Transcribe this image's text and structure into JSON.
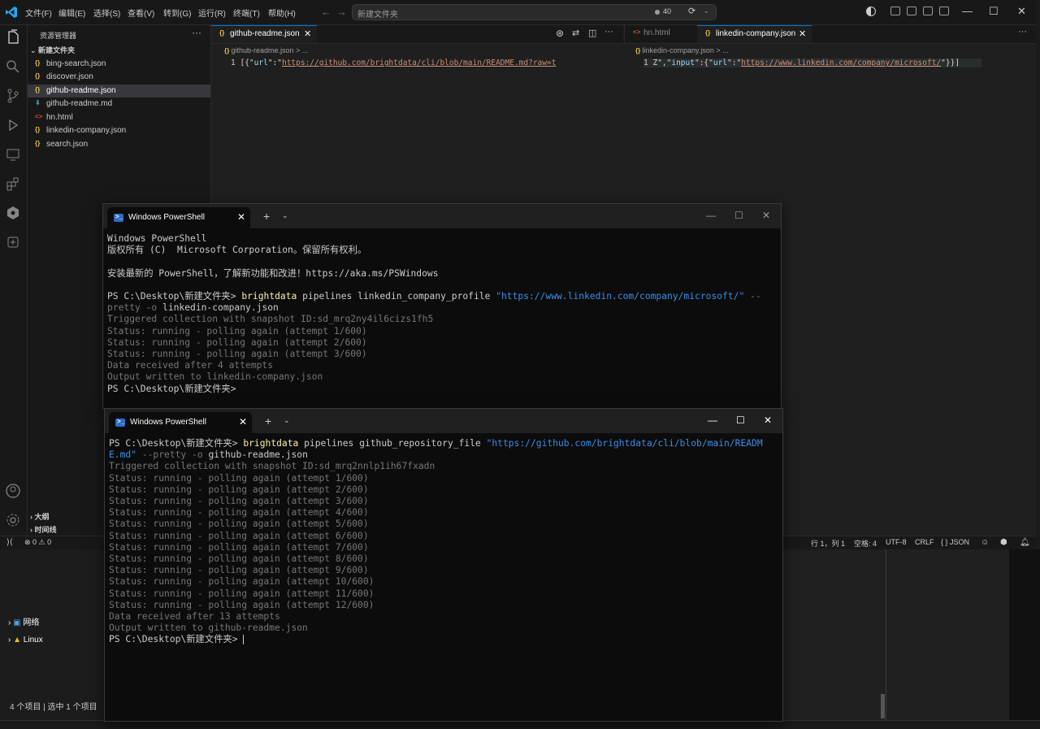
{
  "vscode": {
    "menu": [
      "文件(F)",
      "编辑(E)",
      "选择(S)",
      "查看(V)",
      "转到(G)",
      "运行(R)",
      "终端(T)",
      "帮助(H)"
    ],
    "command_center": {
      "placeholder": "新建文件夹",
      "count": "40"
    },
    "sidebar": {
      "title": "资源管理器",
      "more": "···",
      "folder": "新建文件夹",
      "files": [
        {
          "name": "bing-search.json",
          "icon": "{}"
        },
        {
          "name": "discover.json",
          "icon": "{}"
        },
        {
          "name": "github-readme.json",
          "icon": "{}",
          "selected": true
        },
        {
          "name": "github-readme.md",
          "icon": "⬇"
        },
        {
          "name": "hn.html",
          "icon": "<>"
        },
        {
          "name": "linkedin-company.json",
          "icon": "{}"
        },
        {
          "name": "search.json",
          "icon": "{}"
        }
      ],
      "outline": "大纲",
      "timeline": "时间线"
    },
    "editor_left": {
      "tab": "github-readme.json",
      "breadcrumb": "github-readme.json  >  ...",
      "line_number": "1",
      "code": {
        "p1": "[{\"",
        "key": "url",
        "p2": "\":\"",
        "value": "https://github.com/brightdata/cli/blob/main/README.md?raw=t"
      }
    },
    "editor_right": {
      "tab_inactive": "hn.html",
      "tab_active": "linkedin-company.json",
      "breadcrumb": "linkedin-company.json  >  ...",
      "line_number": "1",
      "code": {
        "p1": "Z\",\"",
        "key1": "input",
        "p2": "\":{\"",
        "key2": "url",
        "p3": "\":\"",
        "value": "https://www.linkedin.com/company/microsoft/",
        "p4": "\"}}]"
      }
    },
    "status": {
      "errors": "⊗ 0 ⚠ 0",
      "position": "行 1，列 1",
      "spaces": "空格: 4",
      "encoding": "UTF-8",
      "eol": "CRLF",
      "language": "{ } JSON"
    }
  },
  "explorer": {
    "items": [
      "网络",
      "Linux"
    ],
    "status": "4 个项目   |   选中 1 个项目"
  },
  "terminal1": {
    "title": "Windows PowerShell",
    "lines": [
      "Windows PowerShell",
      "版权所有 (C)  Microsoft Corporation。保留所有权利。",
      "",
      "安装最新的 PowerShell，了解新功能和改进！https://aka.ms/PSWindows",
      ""
    ],
    "prompt": "PS C:\\Desktop\\新建文件夹> ",
    "cmd": "brightdata",
    "args": " pipelines linkedin_company_profile ",
    "url": "\"https://www.linkedin.com/company/microsoft/\"",
    "flag_a": " --",
    "flag_b": "pretty -o",
    "out_file": " linkedin-company.json",
    "output": [
      "Triggered collection with snapshot ID:sd_mrq2ny4il6cizs1fh5",
      "Status: running - polling again (attempt 1/600)",
      "Status: running - polling again (attempt 2/600)",
      "Status: running - polling again (attempt 3/600)",
      "Data received after 4 attempts",
      "Output written to linkedin-company.json"
    ],
    "final_prompt": "PS C:\\Desktop\\新建文件夹>"
  },
  "terminal2": {
    "title": "Windows PowerShell",
    "prompt": "PS C:\\Desktop\\新建文件夹> ",
    "cmd": "brightdata",
    "args": " pipelines github_repository_file ",
    "url_a": "\"https://github.com/brightdata/cli/blob/main/READM",
    "url_b": "E.md\"",
    "flag": " --pretty -o",
    "out_file": " github-readme.json",
    "output": [
      "Triggered collection with snapshot ID:sd_mrq2nnlp1ih67fxadn",
      "Status: running - polling again (attempt 1/600)",
      "Status: running - polling again (attempt 2/600)",
      "Status: running - polling again (attempt 3/600)",
      "Status: running - polling again (attempt 4/600)",
      "Status: running - polling again (attempt 5/600)",
      "Status: running - polling again (attempt 6/600)",
      "Status: running - polling again (attempt 7/600)",
      "Status: running - polling again (attempt 8/600)",
      "Status: running - polling again (attempt 9/600)",
      "Status: running - polling again (attempt 10/600)",
      "Status: running - polling again (attempt 11/600)",
      "Status: running - polling again (attempt 12/600)",
      "Data received after 13 attempts",
      "Output written to github-readme.json"
    ],
    "final_prompt": "PS C:\\Desktop\\新建文件夹> "
  },
  "colors": {
    "accent": "#0078d4",
    "ps_command": "#f9f1a5",
    "ps_string": "#3b8eea",
    "ps_dim": "#767676",
    "json_key": "#9cdcfe",
    "json_string": "#ce9178"
  }
}
